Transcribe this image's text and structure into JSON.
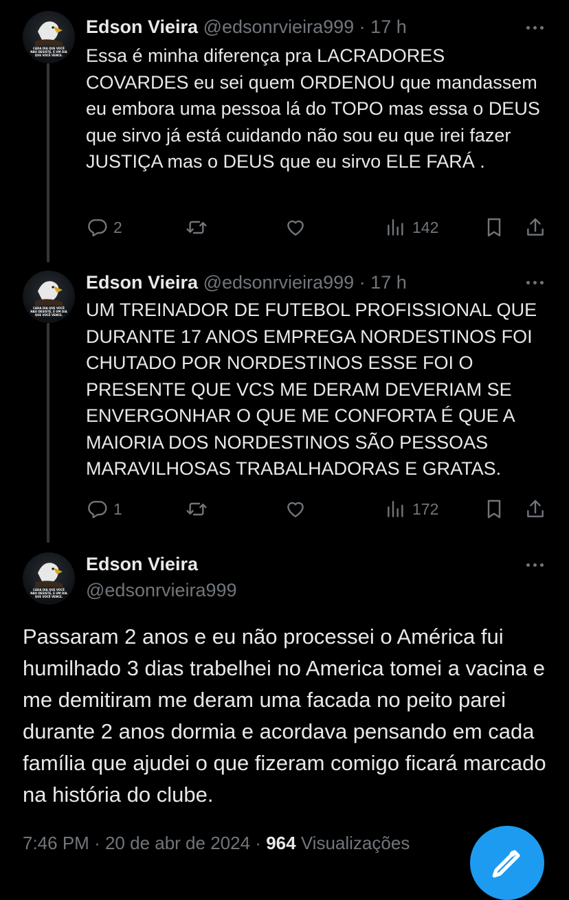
{
  "tweets": [
    {
      "name": "Edson Vieira",
      "handle": "@edsonrvieira999",
      "separator": "·",
      "time": "17 h",
      "text": "Essa é minha diferença pra LACRADORES COVARDES eu sei quem ORDENOU que mandassem eu embora uma pessoa lá do TOPO mas essa o DEUS que sirvo já está cuidando não sou eu que irei fazer JUSTIÇA mas o DEUS que eu sirvo ELE FARÁ .",
      "replies": "2",
      "retweets": "",
      "likes": "",
      "views": "142"
    },
    {
      "name": "Edson Vieira",
      "handle": "@edsonrvieira999",
      "separator": "·",
      "time": "17 h",
      "text": "UM TREINADOR DE FUTEBOL PROFISSIONAL QUE DURANTE 17 ANOS EMPREGA NORDESTINOS FOI CHUTADO POR NORDESTINOS ESSE FOI O PRESENTE QUE VCS ME DERAM DEVERIAM SE ENVERGONHAR O QUE ME CONFORTA É QUE A MAIORIA DOS NORDESTINOS SÃO PESSOAS MARAVILHOSAS TRABALHADORAS E GRATAS.",
      "replies": "1",
      "retweets": "",
      "likes": "",
      "views": "172"
    }
  ],
  "main_tweet": {
    "name": "Edson Vieira",
    "handle": "@edsonrvieira999",
    "text": "Passaram  2 anos e eu não processei o América fui humilhado 3 dias trabelhei no America tomei a vacina e me demitiram me deram uma facada no peito parei durante 2 anos dormia e acordava pensando em cada família que ajudei o que fizeram comigo ficará marcado na história do clube.",
    "time": "7:46 PM",
    "date": "20 de abr de 2024",
    "separator": "·",
    "views_count": "964",
    "views_label": "Visualizações"
  },
  "avatar_caption": [
    "CADA DIA QUE VOCÊ",
    "NÃO DESISTE, É UM DIA",
    "QUE VOCÊ VENCE."
  ],
  "icons": {
    "reply": "reply-icon",
    "retweet": "retweet-icon",
    "like": "heart-icon",
    "views": "views-chart-icon",
    "bookmark": "bookmark-icon",
    "share": "share-icon",
    "more": "more-dots-icon",
    "compose": "compose-icon"
  },
  "colors": {
    "background": "#000000",
    "text": "#e7e9ea",
    "secondary": "#71767b",
    "accent": "#1d9bf0",
    "thread_line": "#333639"
  }
}
